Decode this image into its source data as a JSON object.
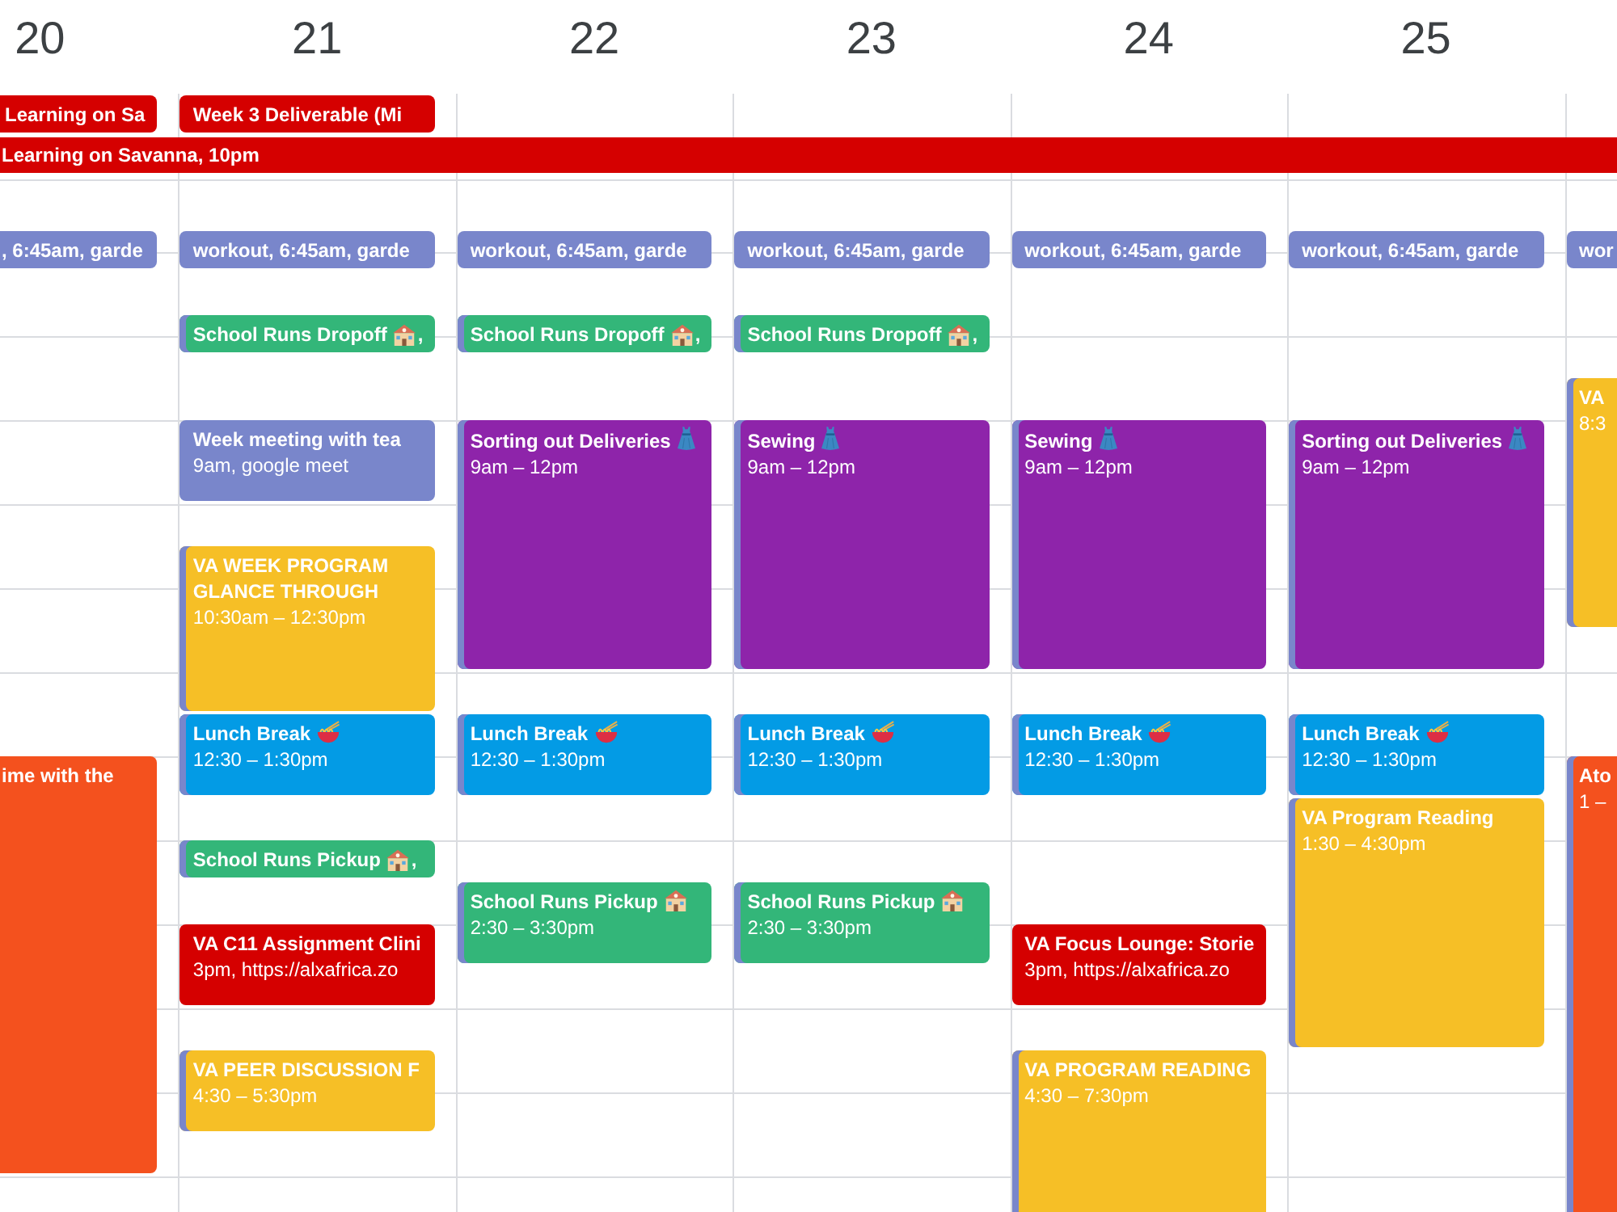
{
  "days": [
    {
      "date": "20",
      "all_day": [
        {
          "title": "Learning on Sa",
          "color": "#d50000"
        }
      ],
      "events": [
        {
          "kind": "chip",
          "title": ", 6:45am, garde",
          "color": "#7986cb"
        },
        {
          "kind": "block",
          "title": "ime with the",
          "color": "#f4511e",
          "stripe": false
        }
      ]
    },
    {
      "date": "21",
      "all_day": [
        {
          "title": "Week 3 Deliverable (Mi",
          "color": "#d50000"
        }
      ],
      "events": [
        {
          "kind": "chip",
          "title": "workout, 6:45am, garde",
          "color": "#7986cb"
        },
        {
          "kind": "chip",
          "title": "School Runs Dropoff",
          "suffix": ",",
          "color": "#33b679",
          "stripe": true
        },
        {
          "kind": "block",
          "title": "Week meeting with tea",
          "time": "9am, google meet",
          "color": "#7986cb"
        },
        {
          "kind": "block",
          "title": "VA WEEK PROGRAM GLANCE THROUGH",
          "time": "10:30am – 12:30pm",
          "color": "#f6bf26",
          "stripe": true
        },
        {
          "kind": "block",
          "title": "Lunch Break",
          "time": "12:30 – 1:30pm",
          "color": "#039be5",
          "stripe": true
        },
        {
          "kind": "chip",
          "title": "School Runs Pickup",
          "suffix": ",",
          "color": "#33b679",
          "stripe": true
        },
        {
          "kind": "block",
          "title": "VA C11 Assignment Clini",
          "time": "3pm, https://alxafrica.zo",
          "color": "#d50000",
          "stripe": false
        },
        {
          "kind": "block",
          "title": "VA PEER DISCUSSION F",
          "time": "4:30 – 5:30pm",
          "color": "#f6bf26",
          "stripe": true
        }
      ]
    },
    {
      "date": "22",
      "events": [
        {
          "kind": "chip",
          "title": "workout, 6:45am, garde",
          "color": "#7986cb"
        },
        {
          "kind": "chip",
          "title": "School Runs Dropoff",
          "suffix": ",",
          "color": "#33b679",
          "stripe": true
        },
        {
          "kind": "block",
          "title": "Sorting out Deliveries",
          "time": "9am – 12pm",
          "color": "#8e24aa",
          "stripe": true
        },
        {
          "kind": "block",
          "title": "Lunch Break",
          "time": "12:30 – 1:30pm",
          "color": "#039be5",
          "stripe": true
        },
        {
          "kind": "block",
          "title": "School Runs Pickup",
          "time": "2:30 – 3:30pm",
          "color": "#33b679",
          "stripe": true
        }
      ]
    },
    {
      "date": "23",
      "events": [
        {
          "kind": "chip",
          "title": "workout, 6:45am, garde",
          "color": "#7986cb"
        },
        {
          "kind": "chip",
          "title": "School Runs Dropoff",
          "suffix": ",",
          "color": "#33b679",
          "stripe": true
        },
        {
          "kind": "block",
          "title": "Sewing",
          "time": "9am – 12pm",
          "color": "#8e24aa",
          "stripe": true
        },
        {
          "kind": "block",
          "title": "Lunch Break",
          "time": "12:30 – 1:30pm",
          "color": "#039be5",
          "stripe": true
        },
        {
          "kind": "block",
          "title": "School Runs Pickup",
          "time": "2:30 – 3:30pm",
          "color": "#33b679",
          "stripe": true
        }
      ]
    },
    {
      "date": "24",
      "events": [
        {
          "kind": "chip",
          "title": "workout, 6:45am, garde",
          "color": "#7986cb"
        },
        {
          "kind": "block",
          "title": "Sewing",
          "time": "9am – 12pm",
          "color": "#8e24aa",
          "stripe": true
        },
        {
          "kind": "block",
          "title": "Lunch Break",
          "time": "12:30 – 1:30pm",
          "color": "#039be5",
          "stripe": true
        },
        {
          "kind": "block",
          "title": "VA Focus Lounge: Storie",
          "time": "3pm, https://alxafrica.zo",
          "color": "#d50000",
          "stripe": false
        },
        {
          "kind": "block",
          "title": "VA PROGRAM READING",
          "time": "4:30 – 7:30pm",
          "color": "#f6bf26",
          "stripe": true
        }
      ]
    },
    {
      "date": "25",
      "events": [
        {
          "kind": "chip",
          "title": "workout, 6:45am, garde",
          "color": "#7986cb"
        },
        {
          "kind": "block",
          "title": "Sorting out Deliveries",
          "time": "9am – 12pm",
          "color": "#8e24aa",
          "stripe": true
        },
        {
          "kind": "block",
          "title": "Lunch Break",
          "time": "12:30 – 1:30pm",
          "color": "#039be5",
          "stripe": true
        },
        {
          "kind": "block",
          "title": "VA Program Reading",
          "time": "1:30 – 4:30pm",
          "color": "#f6bf26",
          "stripe": true
        }
      ]
    },
    {
      "events": [
        {
          "kind": "chip",
          "title": "wor",
          "color": "#7986cb"
        },
        {
          "kind": "block",
          "title": "VA",
          "time": "8:3",
          "color": "#f6bf26",
          "stripe": true
        },
        {
          "kind": "block",
          "title": "Ato",
          "time": "1 –",
          "color": "#f4511e",
          "stripe": true
        }
      ]
    }
  ],
  "spanning_event": {
    "title": "Learning on Savanna, 10pm",
    "color": "#d50000"
  }
}
